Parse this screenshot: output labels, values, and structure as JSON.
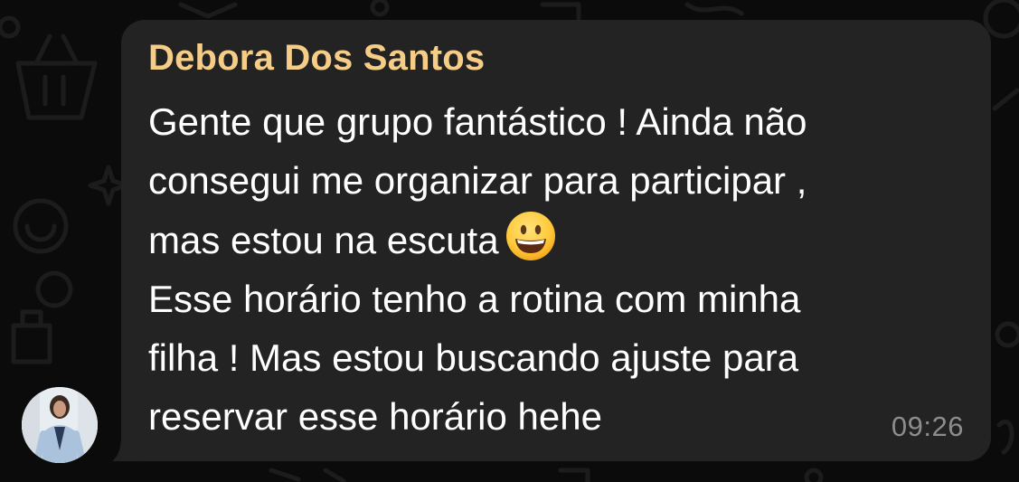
{
  "message": {
    "sender": "Debora Dos Santos",
    "lines": [
      "Gente que grupo fantástico ! Ainda não",
      "consegui me organizar para participar ,",
      "mas estou na escuta",
      "Esse horário tenho a rotina com minha",
      "filha ! Mas estou buscando ajuste para",
      "reservar esse horário hehe"
    ],
    "emoji": "grinning-face-emoji",
    "time": "09:26"
  },
  "colors": {
    "background": "#0b0b0b",
    "bubble": "#232323",
    "sender_name": "#f5cd86",
    "message_text": "#ffffff",
    "timestamp": "#8d8d8d"
  },
  "icons": {
    "avatar": "sender-profile-photo",
    "background": "chat-doodle-wallpaper"
  }
}
